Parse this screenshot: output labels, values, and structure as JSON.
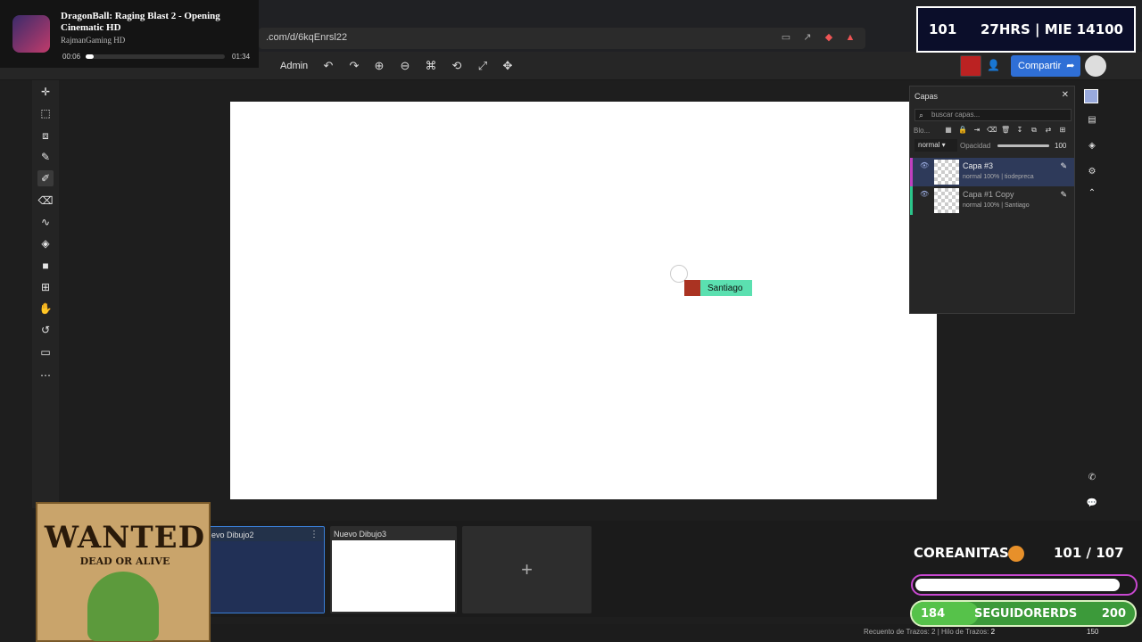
{
  "browser": {
    "url": ".com/d/6kqEnrsl22"
  },
  "toolbar": {
    "admin_label": "Admin",
    "share_label": "Compartir"
  },
  "canvas": {
    "cursor_user": "Santiago"
  },
  "layers": {
    "title": "Capas",
    "search_placeholder": "buscar capas...",
    "block_label": "Blo...",
    "blend_mode": "normal",
    "opacity_label": "Opacidad",
    "opacity_value": "100",
    "opacity_fraction": 1.0,
    "items": [
      {
        "name": "Capa #3",
        "meta": "normal 100% | tiodepreca",
        "selected": true
      },
      {
        "name": "Capa #1 Copy",
        "meta": "normal 100% | Santiago",
        "selected": false
      }
    ]
  },
  "drawings": {
    "items": [
      {
        "title": "evo Dibujo2",
        "active": true
      },
      {
        "title": "Nuevo Dibujo3",
        "active": false
      }
    ],
    "add_symbol": "+"
  },
  "status": {
    "text": "Recuento de Trazos: 2 | Hilo de Trazos:",
    "highlight": "2",
    "count": "150"
  },
  "player": {
    "title": "DragonBall: Raging Blast 2 - Opening Cinematic HD",
    "artist": "RajmanGaming HD",
    "time_current": "00:06",
    "time_total": "01:34",
    "progress": 0.06
  },
  "stream_clock": {
    "left": "101",
    "center": "27HRS | MIE 14",
    "right": "100"
  },
  "poster": {
    "title": "WANTED",
    "subtitle": "DEAD OR ALIVE"
  },
  "goals": {
    "label": "COREANITAS",
    "count": "101  / 107",
    "progress": 0.94,
    "followers_start": "184",
    "followers_label": "SEGUIDORERDS",
    "followers_end": "200",
    "followers_progress": 0.3
  },
  "colors": {
    "accent": "#2f6fd6",
    "cursor_tag": "#5be0b0",
    "goal_border": "#c848d0",
    "followers": "#3c9a3a"
  }
}
